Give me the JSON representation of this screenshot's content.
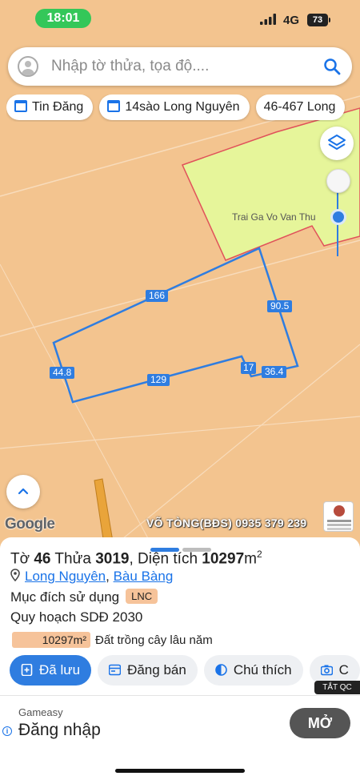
{
  "status_bar": {
    "time": "18:01",
    "network": "4G",
    "battery": "73"
  },
  "search": {
    "placeholder": "Nhập tờ thửa, tọa độ...."
  },
  "chips": [
    {
      "label": "Tin Đăng"
    },
    {
      "label": "14sào Long Nguyên"
    },
    {
      "label": "46-467 Long"
    }
  ],
  "map": {
    "place_label": "Trai Ga Vo Van Thu",
    "edges": [
      "166",
      "90.5",
      "44.8",
      "129",
      "17",
      "36.4"
    ],
    "google_label": "Google",
    "watermark": "VÕ TÒNG(BĐS) 0935 379 239",
    "colors": {
      "land": "#f3c48f",
      "zone": "#e6f59a",
      "zone_border": "#e0525a",
      "parcel_line": "#2f7de0"
    }
  },
  "parcel": {
    "to_label": "Tờ ",
    "to_number": "46",
    "thua_label": " Thửa ",
    "thua_number": "3019",
    "area_label": ", Diện tích ",
    "area_value": "10297",
    "area_unit": "m",
    "area_unit_sup": "2",
    "commune": "Long Nguyên",
    "separator": ", ",
    "district": "Bàu Bàng",
    "purpose_label": "Mục đích sử dụng",
    "purpose_code": "LNC",
    "planning_label": "Quy hoạch SDĐ 2030",
    "planning_area": "10297m²",
    "planning_desc": "Đất trồng cây lâu năm"
  },
  "actions": [
    {
      "label": "Đã lưu"
    },
    {
      "label": "Đăng bán"
    },
    {
      "label": "Chú thích"
    },
    {
      "label": "C"
    }
  ],
  "ad": {
    "close_label": "TẮT QC",
    "brand": "Gameasy",
    "cta": "Đăng nhập",
    "button": "MỞ"
  }
}
